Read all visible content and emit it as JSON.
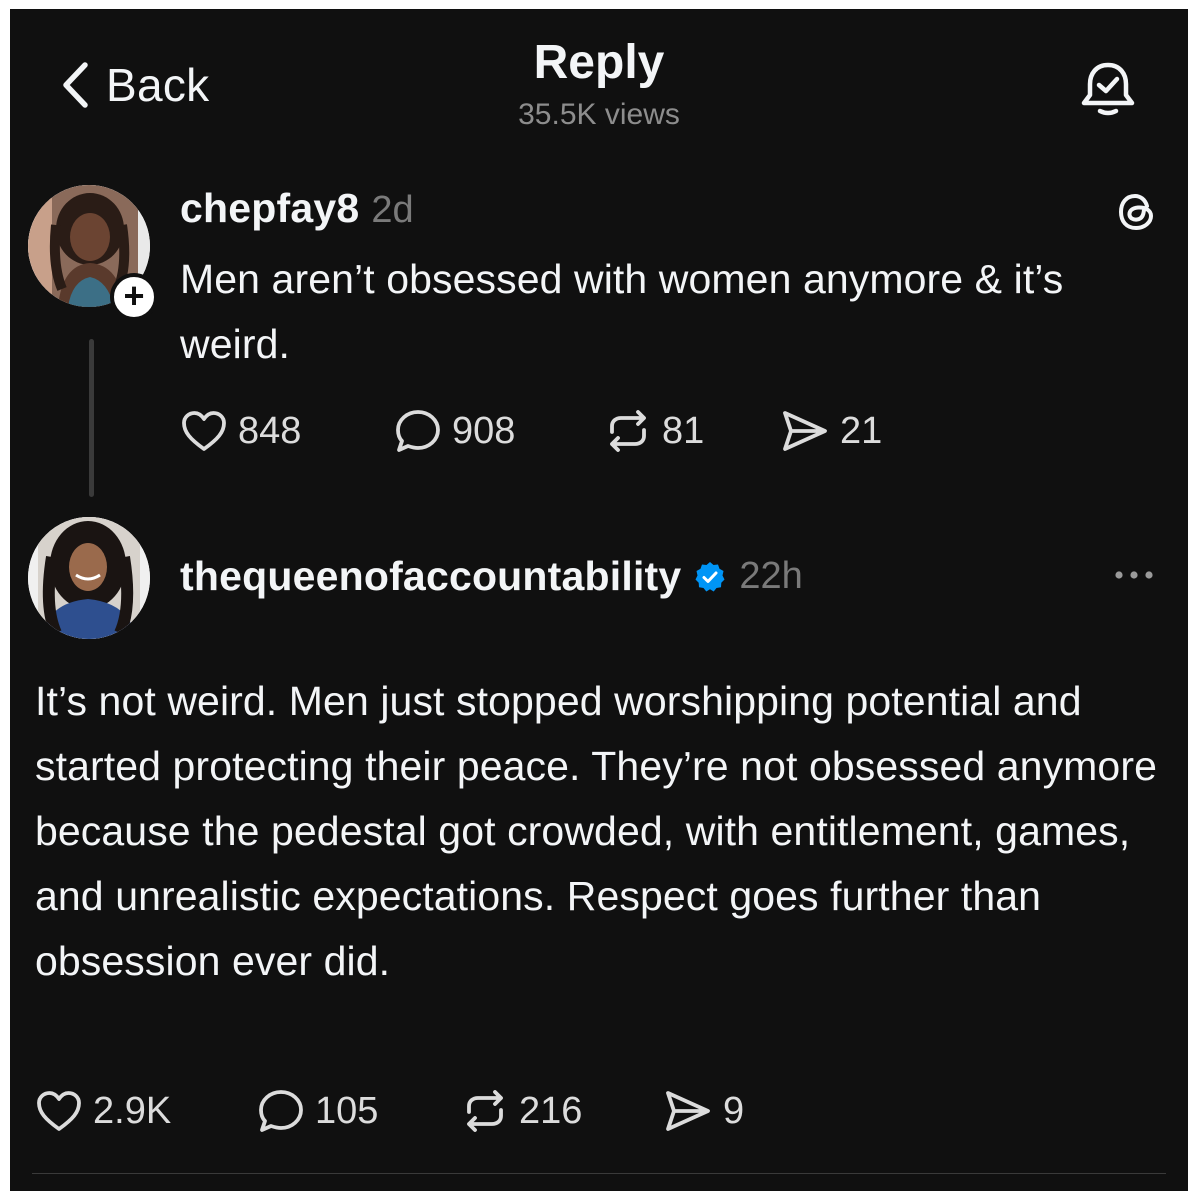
{
  "header": {
    "back_label": "Back",
    "title": "Reply",
    "views": "35.5K views",
    "notify_icon": "bell-check-icon"
  },
  "post": {
    "username": "chepfay8",
    "time": "2d",
    "text": "Men aren’t obsessed with women anymore & it’s weird.",
    "stats": {
      "likes": "848",
      "replies": "908",
      "reposts": "81",
      "shares": "21"
    }
  },
  "reply": {
    "username": "thequeenofaccountability",
    "verified": true,
    "time": "22h",
    "text": "It’s not weird. Men just stopped worshipping potential and started protecting their peace. They’re not obsessed anymore because the pedestal got crowded, with entitlement, games, and unrealistic expectations. Respect goes further than obsession ever did.",
    "stats": {
      "likes": "2.9K",
      "replies": "105",
      "reposts": "216",
      "shares": "9"
    }
  },
  "colors": {
    "background": "#101010",
    "text": "#f3f5f7",
    "muted": "#7a7a7a",
    "verified": "#0095f6"
  }
}
